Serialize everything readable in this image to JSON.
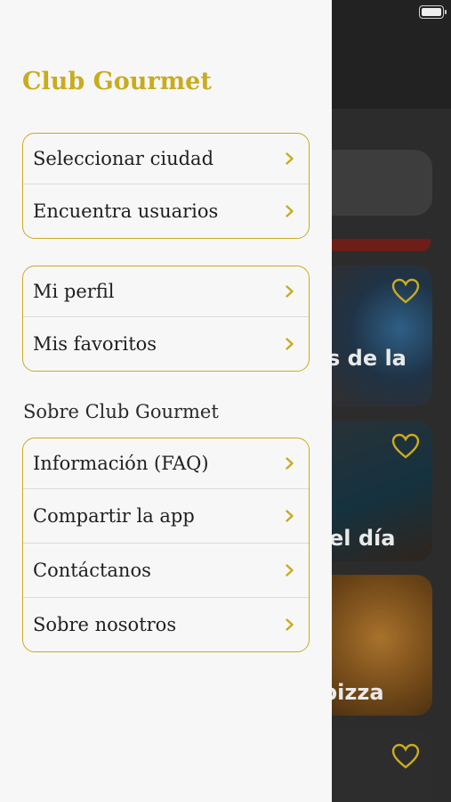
{
  "colors": {
    "accent": "#c9ac1e",
    "drawer_bg": "#f7f7f7",
    "text": "#1f1f1f",
    "dim_bg": "#222222"
  },
  "drawer": {
    "title": "Club Gourmet",
    "groups": [
      {
        "items": [
          {
            "label": "Seleccionar ciudad",
            "icon": "chevron-right-icon"
          },
          {
            "label": "Encuentra usuarios",
            "icon": "chevron-right-icon"
          }
        ]
      },
      {
        "items": [
          {
            "label": "Mi perfil",
            "icon": "chevron-right-icon"
          },
          {
            "label": "Mis favoritos",
            "icon": "chevron-right-icon"
          }
        ]
      },
      {
        "title": "Sobre Club Gourmet",
        "items": [
          {
            "label": "Información (FAQ)",
            "icon": "chevron-right-icon"
          },
          {
            "label": "Compartir la app",
            "icon": "chevron-right-icon"
          },
          {
            "label": "Contáctanos",
            "icon": "chevron-right-icon"
          },
          {
            "label": "Sobre nosotros",
            "icon": "chevron-right-icon"
          }
        ]
      }
    ]
  },
  "background": {
    "cards": [
      {
        "title": "s de la",
        "icon": "heart-icon"
      },
      {
        "title": "el día",
        "icon": "heart-icon"
      },
      {
        "title": "pizza",
        "icon": "heart-icon"
      },
      {
        "title": "",
        "icon": "heart-icon"
      }
    ]
  }
}
